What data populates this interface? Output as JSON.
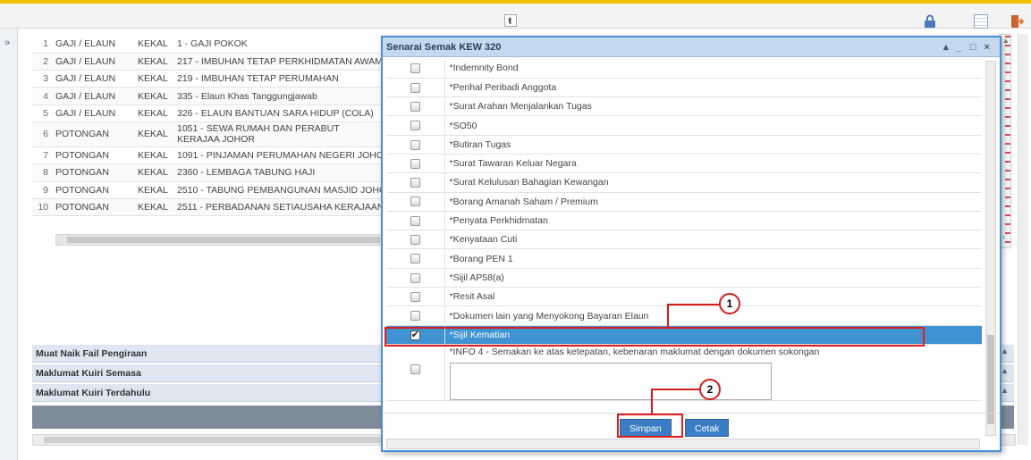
{
  "topbar": {
    "collapse_icon": "double-chevron-up",
    "icons": [
      "lock-icon",
      "grid-icon",
      "exit-icon"
    ]
  },
  "leftrail": {
    "toggle_glyph": "»"
  },
  "allowances": [
    {
      "no": "1",
      "category": "GAJI / ELAUN",
      "status": "KEKAL",
      "desc": "1 - GAJI POKOK"
    },
    {
      "no": "2",
      "category": "GAJI / ELAUN",
      "status": "KEKAL",
      "desc": "217 - IMBUHAN TETAP PERKHIDMATAN AWAM"
    },
    {
      "no": "3",
      "category": "GAJI / ELAUN",
      "status": "KEKAL",
      "desc": "219 - IMBUHAN TETAP PERUMAHAN"
    },
    {
      "no": "4",
      "category": "GAJI / ELAUN",
      "status": "KEKAL",
      "desc": "335 - Elaun Khas Tanggungjawab"
    },
    {
      "no": "5",
      "category": "GAJI / ELAUN",
      "status": "KEKAL",
      "desc": "326 - ELAUN BANTUAN SARA HIDUP (COLA)"
    },
    {
      "no": "6",
      "category": "POTONGAN",
      "status": "KEKAL",
      "desc": "1051 - SEWA RUMAH DAN PERABUT KERAJAA JOHOR"
    },
    {
      "no": "7",
      "category": "POTONGAN",
      "status": "KEKAL",
      "desc": "1091 - PINJAMAN PERUMAHAN NEGERI JOHO"
    },
    {
      "no": "8",
      "category": "POTONGAN",
      "status": "KEKAL",
      "desc": "2360 - LEMBAGA TABUNG HAJI"
    },
    {
      "no": "9",
      "category": "POTONGAN",
      "status": "KEKAL",
      "desc": "2510 - TABUNG PEMBANGUNAN MASJID JOHO"
    },
    {
      "no": "10",
      "category": "POTONGAN",
      "status": "KEKAL",
      "desc": "2511 - PERBADANAN SETIAUSAHA KERAJAAN"
    }
  ],
  "sections": {
    "upload": "Muat Naik Fail Pengiraan",
    "current_query": "Maklumat Kuiri Semasa",
    "previous_query": "Maklumat Kuiri Terdahulu"
  },
  "dialog": {
    "title": "Senarai Semak KEW 320",
    "controls": "▴ _ □ ×",
    "items": [
      {
        "label": "*Indemnity Bond",
        "checked": false
      },
      {
        "label": "*Perihal Peribadi Anggota",
        "checked": false
      },
      {
        "label": "*Surat Arahan Menjalankan Tugas",
        "checked": false
      },
      {
        "label": "*SO50",
        "checked": false
      },
      {
        "label": "*Butiran Tugas",
        "checked": false
      },
      {
        "label": "*Surat Tawaran Keluar Negara",
        "checked": false
      },
      {
        "label": "*Surat Kelulusan Bahagian Kewangan",
        "checked": false
      },
      {
        "label": "*Borang Amanah Saham / Premium",
        "checked": false
      },
      {
        "label": "*Penyata Perkhidmatan",
        "checked": false
      },
      {
        "label": "*Kenyataan Cuti",
        "checked": false
      },
      {
        "label": "*Borang PEN 1",
        "checked": false
      },
      {
        "label": "*Sijil AP58(a)",
        "checked": false
      },
      {
        "label": "*Resit Asal",
        "checked": false
      },
      {
        "label": "*Dokumen lain yang Menyokong Bayaran Elaun",
        "checked": false
      },
      {
        "label": "*Sijil Kematian",
        "checked": true
      }
    ],
    "info4_label": "*INFO 4 - Semakan ke atas ketepatan, kebenaran maklumat dengan dokumen sokongan",
    "info4_value": "",
    "save_label": "Simpan",
    "print_label": "Cetak"
  },
  "callouts": {
    "one": "1",
    "two": "2"
  },
  "colors": {
    "accent": "#f2c200",
    "dialog_border": "#4a90d9",
    "selected_row": "#3f93d3",
    "highlight": "#e21b1b",
    "button": "#3b7dc4"
  }
}
